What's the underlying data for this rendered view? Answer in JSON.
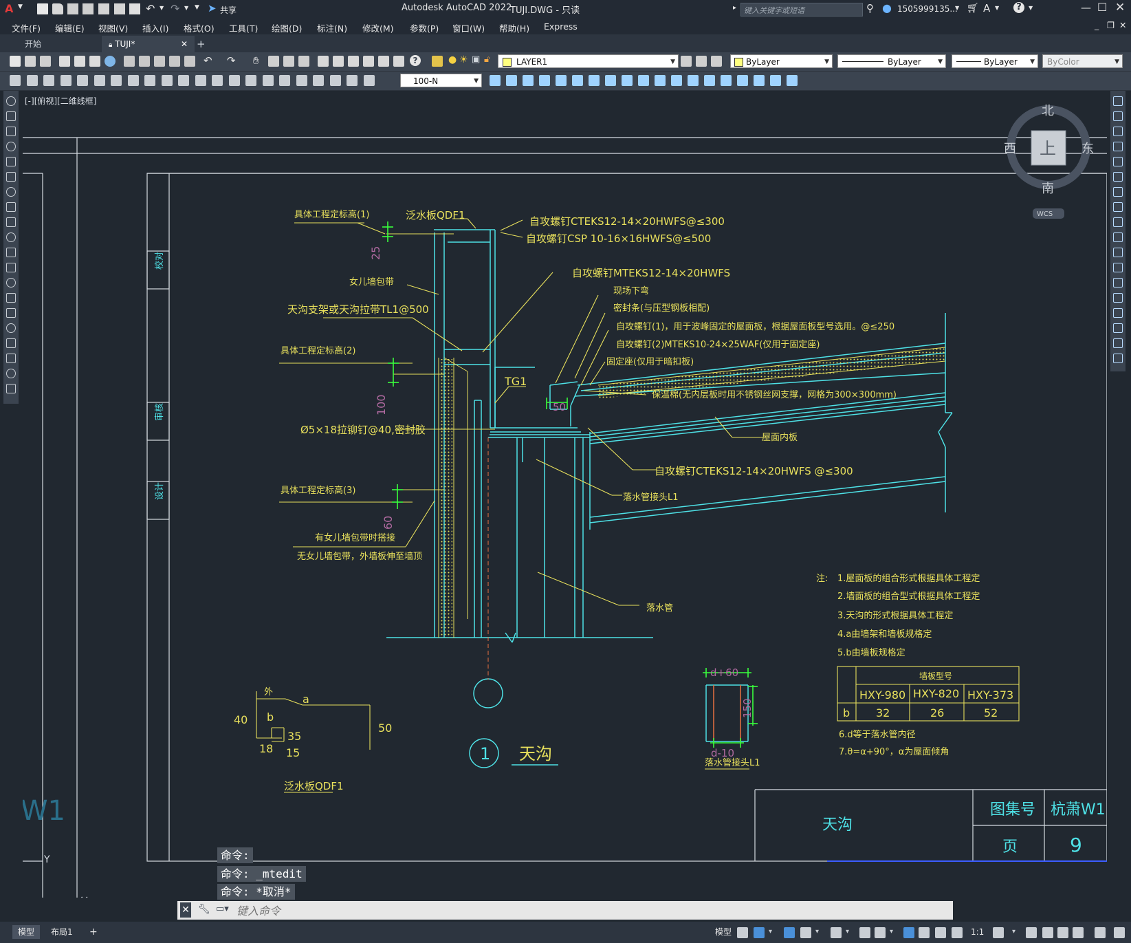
{
  "app": {
    "logo": "A",
    "title": "Autodesk AutoCAD 2022",
    "document": "TUJI.DWG - 只读",
    "share_label": "共享",
    "search_placeholder": "键入关键字或短语",
    "user": "1505999135...",
    "window_controls": [
      "minimize-icon",
      "maximize-icon",
      "close-icon"
    ]
  },
  "menu": {
    "items": [
      "文件(F)",
      "编辑(E)",
      "视图(V)",
      "插入(I)",
      "格式(O)",
      "工具(T)",
      "绘图(D)",
      "标注(N)",
      "修改(M)",
      "参数(P)",
      "窗口(W)",
      "帮助(H)",
      "Express"
    ]
  },
  "tabs": {
    "start": "开始",
    "file": "TUJI*",
    "add": "+"
  },
  "toolbar": {
    "layer": "LAYER1",
    "color": "ByLayer",
    "linetype": "ByLayer",
    "lineweight": "ByLayer",
    "plotstyle": "ByColor",
    "dimstyle": "100-N"
  },
  "viewport": {
    "label": "[-][俯视][二维线框]",
    "viewcube": {
      "north": "北",
      "south": "南",
      "east": "东",
      "west": "西",
      "face": "上",
      "wcs": "WCS"
    }
  },
  "drawing": {
    "labels_left": {
      "elev1": "具体工程定标高(1)",
      "elev2": "具体工程定标高(2)",
      "elev3": "具体工程定标高(3)",
      "parapet_band": "女儿墙包带",
      "support": "天沟支架或天沟拉带TL1@500",
      "rivet": "Ø5×18拉铆钉@40,密封胶",
      "band_note1": "有女儿墙包带时搭接",
      "band_note2": "无女儿墙包带，外墙板伸至墙顶",
      "flashing_top": "泛水板QDF1",
      "dim25": "25",
      "dim100": "100",
      "dim60": "60"
    },
    "labels_right": {
      "screw1": "自攻螺钉CTEKS12-14×20HWFS@≤300",
      "screw2": "自攻螺钉CSP 10-16×16HWFS@≤500",
      "screw3": "自攻螺钉MTEKS12-14×20HWFS",
      "bend": "现场下弯",
      "seal": "密封条(与压型钢板相配)",
      "screw4": "自攻螺钉(1)，用于波峰固定的屋面板，根据屋面板型号选用。@≤250",
      "screw5": "自攻螺钉(2)MTEKS10-24×25WAF(仅用于固定座)",
      "seat": "固定座(仅用于暗扣板)",
      "insulation": "保温棉(无内层板时用不锈钢丝网支撑，网格为300×300mm)",
      "inner_panel": "屋面内板",
      "screw6": "自攻螺钉CTEKS12-14×20HWFS @≤300",
      "joint": "落水管接头L1",
      "downpipe": "落水管",
      "tg1": "TG1",
      "dim50": "50"
    },
    "flashing_detail": {
      "outside": "外",
      "a": "a",
      "b": "b",
      "d40": "40",
      "d50": "50",
      "d35": "35",
      "d18": "18",
      "d15": "15",
      "caption": "泛水板QDF1"
    },
    "gutter_title": {
      "num": "1",
      "text": "天沟"
    },
    "joint_detail": {
      "dim_top": "d+60",
      "dim_side": "150",
      "dim_bottom": "d-10",
      "caption": "落水管接头L1"
    },
    "notes": {
      "prefix": "注:",
      "lines": [
        "1.屋面板的组合形式根据具体工程定",
        "2.墙面板的组合型式根据具体工程定",
        "3.天沟的形式根据具体工程定",
        "4.a由墙架和墙板规格定",
        "5.b由墙板规格定"
      ],
      "table_header": "墙板型号",
      "table_cols": [
        "HXY-980",
        "HXY-820",
        "HXY-373"
      ],
      "table_row_label": "b",
      "table_values": [
        "32",
        "26",
        "52"
      ],
      "line6": "6.d等于落水管内径",
      "line7": "7.θ=α+90°，α为屋面倾角"
    },
    "title_block": {
      "name": "天沟",
      "atlas_label": "图集号",
      "atlas_value": "杭萧W1",
      "page_label": "页",
      "page_value": "9"
    },
    "side_strip": [
      "校对",
      "审核",
      "设计"
    ],
    "left_partial": "W1"
  },
  "command": {
    "history": [
      "命令:",
      "命令: _mtedit",
      "命令: *取消*"
    ],
    "placeholder": "键入命令"
  },
  "status": {
    "tabs": [
      "模型",
      "布局1",
      "+"
    ],
    "model_label": "模型",
    "scale": "1:1"
  },
  "colors": {
    "cyan": "#4ee1e6",
    "yellow": "#e8e05c",
    "green": "#39ff3c",
    "white": "#d6dce2",
    "magenta": "#b06aa0",
    "bg": "#212830"
  }
}
